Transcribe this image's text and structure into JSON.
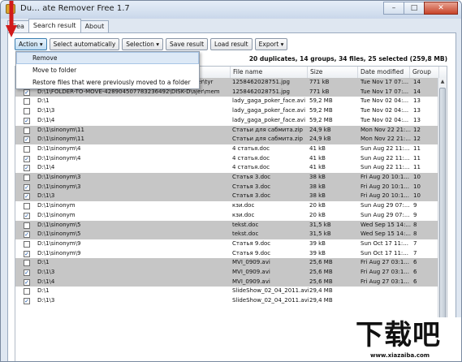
{
  "window": {
    "title": "Du… ate Remover Free 1.7",
    "controls": {
      "minimize": "–",
      "maximize": "□",
      "close": "✕"
    }
  },
  "tabs": [
    {
      "label": "Sea"
    },
    {
      "label": "Search result",
      "active": true
    },
    {
      "label": "About"
    }
  ],
  "toolbar": {
    "action": "Action ▾",
    "select_automatically": "Select automatically",
    "selection": "Selection ▾",
    "save_result": "Save result",
    "load_result": "Load result",
    "export": "Export ▾"
  },
  "summary": "20 duplicates, 14 groups, 34 files, 25 selected (259,8 MB)",
  "menu": {
    "items": [
      "Remove",
      "Move to folder",
      "Restore files that were previously moved to a folder"
    ]
  },
  "columns": {
    "file_name": "File name",
    "size": "Size",
    "date_modified": "Date modified",
    "group": "Group"
  },
  "rows": [
    {
      "checked": true,
      "shaded": true,
      "folder": "D:\\1\\FOLDER-TO-MOVE-428904507783236492\\DISK-D\\ajer\\tyr",
      "file": "1258462028751.jpg",
      "size": "771 kB",
      "date": "Tue Nov 17 07:...",
      "group": "14"
    },
    {
      "checked": true,
      "shaded": true,
      "folder": "D:\\1\\FOLDER-TO-MOVE-428904507783236492\\DISK-D\\ajer\\mem",
      "file": "1258462028751.jpg",
      "size": "771 kB",
      "date": "Tue Nov 17 07:...",
      "group": "14"
    },
    {
      "checked": false,
      "shaded": false,
      "folder": "D:\\1",
      "file": "lady_gaga_poker_face.avi",
      "size": "59,2 MB",
      "date": "Tue Nov 02 04:...",
      "group": "13"
    },
    {
      "checked": false,
      "shaded": false,
      "folder": "D:\\1\\3",
      "file": "lady_gaga_poker_face.avi",
      "size": "59,2 MB",
      "date": "Tue Nov 02 04:...",
      "group": "13"
    },
    {
      "checked": true,
      "shaded": false,
      "folder": "D:\\1\\4",
      "file": "lady_gaga_poker_face.avi",
      "size": "59,2 MB",
      "date": "Tue Nov 02 04:...",
      "group": "13"
    },
    {
      "checked": false,
      "shaded": true,
      "folder": "D:\\1\\sinonym\\11",
      "file": "Статьи для сабмита.zip",
      "size": "24,9 kB",
      "date": "Mon Nov 22 21:...",
      "group": "12"
    },
    {
      "checked": true,
      "shaded": true,
      "folder": "D:\\1\\sinonym\\11",
      "file": "Статьи для сабмита.zip",
      "size": "24,9 kB",
      "date": "Mon Nov 22 21:...",
      "group": "12"
    },
    {
      "checked": false,
      "shaded": false,
      "folder": "D:\\1\\sinonym\\4",
      "file": "4 статья.doc",
      "size": "41 kB",
      "date": "Sun Aug 22 11:...",
      "group": "11"
    },
    {
      "checked": true,
      "shaded": false,
      "folder": "D:\\1\\sinonym\\4",
      "file": "4 статья.doc",
      "size": "41 kB",
      "date": "Sun Aug 22 11:...",
      "group": "11"
    },
    {
      "checked": true,
      "shaded": false,
      "folder": "D:\\1\\4",
      "file": "4 статья.doc",
      "size": "41 kB",
      "date": "Sun Aug 22 11:...",
      "group": "11"
    },
    {
      "checked": false,
      "shaded": true,
      "folder": "D:\\1\\sinonym\\3",
      "file": "Статья 3.doc",
      "size": "38 kB",
      "date": "Fri Aug 20 10:1...",
      "group": "10"
    },
    {
      "checked": true,
      "shaded": true,
      "folder": "D:\\1\\sinonym\\3",
      "file": "Статья 3.doc",
      "size": "38 kB",
      "date": "Fri Aug 20 10:1...",
      "group": "10"
    },
    {
      "checked": true,
      "shaded": true,
      "folder": "D:\\1\\3",
      "file": "Статья 3.doc",
      "size": "38 kB",
      "date": "Fri Aug 20 10:1...",
      "group": "10"
    },
    {
      "checked": false,
      "shaded": false,
      "folder": "D:\\1\\sinonym",
      "file": "кзи.doc",
      "size": "20 kB",
      "date": "Sun Aug 29 07:...",
      "group": "9"
    },
    {
      "checked": true,
      "shaded": false,
      "folder": "D:\\1\\sinonym",
      "file": "кзи.doc",
      "size": "20 kB",
      "date": "Sun Aug 29 07:...",
      "group": "9"
    },
    {
      "checked": false,
      "shaded": true,
      "folder": "D:\\1\\sinonym\\5",
      "file": "tekst.doc",
      "size": "31,5 kB",
      "date": "Wed Sep 15 14:...",
      "group": "8"
    },
    {
      "checked": true,
      "shaded": true,
      "folder": "D:\\1\\sinonym\\5",
      "file": "tekst.doc",
      "size": "31,5 kB",
      "date": "Wed Sep 15 14:...",
      "group": "8"
    },
    {
      "checked": false,
      "shaded": false,
      "folder": "D:\\1\\sinonym\\9",
      "file": "Статья 9.doc",
      "size": "39 kB",
      "date": "Sun Oct 17 11:...",
      "group": "7"
    },
    {
      "checked": true,
      "shaded": false,
      "folder": "D:\\1\\sinonym\\9",
      "file": "Статья 9.doc",
      "size": "39 kB",
      "date": "Sun Oct 17 11:...",
      "group": "7"
    },
    {
      "checked": false,
      "shaded": true,
      "folder": "D:\\1",
      "file": "MVI_0909.avi",
      "size": "25,6 MB",
      "date": "Fri Aug 27 03:1...",
      "group": "6"
    },
    {
      "checked": true,
      "shaded": true,
      "folder": "D:\\1\\3",
      "file": "MVI_0909.avi",
      "size": "25,6 MB",
      "date": "Fri Aug 27 03:1...",
      "group": "6"
    },
    {
      "checked": true,
      "shaded": true,
      "folder": "D:\\1\\4",
      "file": "MVI_0909.avi",
      "size": "25,6 MB",
      "date": "Fri Aug 27 03:1...",
      "group": "6"
    },
    {
      "checked": false,
      "shaded": false,
      "folder": "D:\\1",
      "file": "SlideShow_02_04_2011.avi",
      "size": "29,4 MB",
      "date": "",
      "group": ""
    },
    {
      "checked": true,
      "shaded": false,
      "folder": "D:\\1\\3",
      "file": "SlideShow_02_04_2011.avi",
      "size": "29,4 MB",
      "date": "",
      "group": ""
    }
  ],
  "watermark": {
    "text": "下载吧",
    "url": "www.xiazaiba.com"
  },
  "colors": {
    "row_shaded": "#c6c6c6",
    "highlight": "#dde9f6",
    "arrow": "#d11a1a"
  }
}
